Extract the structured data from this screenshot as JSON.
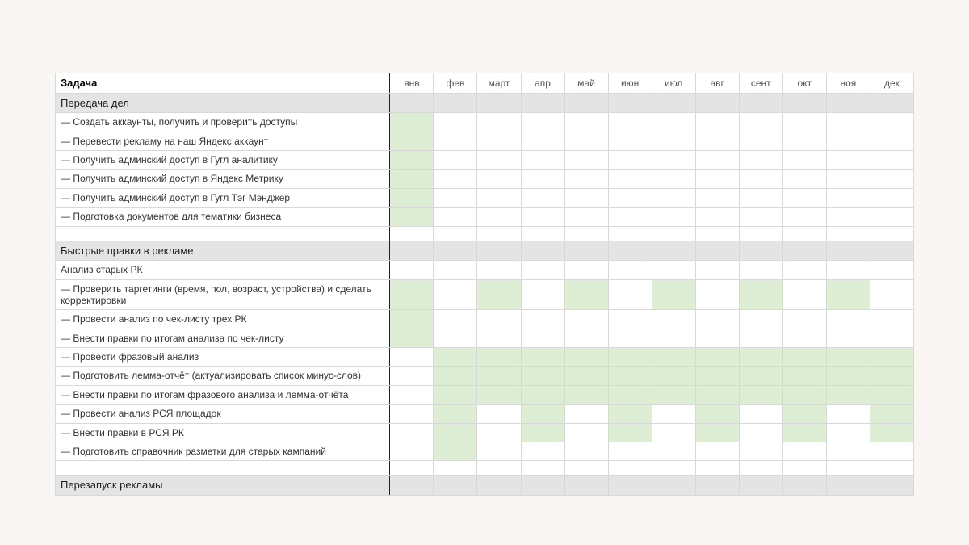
{
  "header": {
    "task": "Задача",
    "months": [
      "янв",
      "фев",
      "март",
      "апр",
      "май",
      "июн",
      "июл",
      "авг",
      "сент",
      "окт",
      "ноя",
      "дек"
    ]
  },
  "sections": [
    {
      "title": "Передача дел",
      "rows": [
        {
          "label": "— Создать аккаунты, получить и проверить доступы",
          "months": [
            1,
            0,
            0,
            0,
            0,
            0,
            0,
            0,
            0,
            0,
            0,
            0
          ]
        },
        {
          "label": "— Перевести рекламу на наш Яндекс аккаунт",
          "months": [
            1,
            0,
            0,
            0,
            0,
            0,
            0,
            0,
            0,
            0,
            0,
            0
          ]
        },
        {
          "label": "— Получить админский доступ в Гугл аналитику",
          "months": [
            1,
            0,
            0,
            0,
            0,
            0,
            0,
            0,
            0,
            0,
            0,
            0
          ]
        },
        {
          "label": "— Получить админский доступ в Яндекс Метрику",
          "months": [
            1,
            0,
            0,
            0,
            0,
            0,
            0,
            0,
            0,
            0,
            0,
            0
          ]
        },
        {
          "label": "— Получить админский доступ в Гугл Тэг Мэнджер",
          "months": [
            1,
            0,
            0,
            0,
            0,
            0,
            0,
            0,
            0,
            0,
            0,
            0
          ]
        },
        {
          "label": "— Подготовка документов для тематики бизнеса",
          "months": [
            1,
            0,
            0,
            0,
            0,
            0,
            0,
            0,
            0,
            0,
            0,
            0
          ]
        }
      ],
      "spacer_after": true
    },
    {
      "title": "Быстрые правки в рекламе",
      "rows": [
        {
          "label": "Анализ старых РК",
          "months": [
            0,
            0,
            0,
            0,
            0,
            0,
            0,
            0,
            0,
            0,
            0,
            0
          ]
        },
        {
          "label": "— Проверить таргетинги (время, пол, возраст, устройства) и сделать корректировки",
          "months": [
            1,
            0,
            1,
            0,
            1,
            0,
            1,
            0,
            1,
            0,
            1,
            0
          ]
        },
        {
          "label": "— Провести анализ по чек-листу трех РК",
          "months": [
            1,
            0,
            0,
            0,
            0,
            0,
            0,
            0,
            0,
            0,
            0,
            0
          ]
        },
        {
          "label": "— Внести правки по итогам анализа по чек-листу",
          "months": [
            1,
            0,
            0,
            0,
            0,
            0,
            0,
            0,
            0,
            0,
            0,
            0
          ]
        },
        {
          "label": "— Провести фразовый анализ",
          "months": [
            0,
            1,
            1,
            1,
            1,
            1,
            1,
            1,
            1,
            1,
            1,
            1
          ]
        },
        {
          "label": "— Подготовить лемма-отчёт (актуализировать список минус-слов)",
          "months": [
            0,
            1,
            1,
            1,
            1,
            1,
            1,
            1,
            1,
            1,
            1,
            1
          ]
        },
        {
          "label": "— Внести правки по итогам фразового анализа и лемма-отчёта",
          "months": [
            0,
            1,
            1,
            1,
            1,
            1,
            1,
            1,
            1,
            1,
            1,
            1
          ]
        },
        {
          "label": "— Провести анализ РСЯ площадок",
          "months": [
            0,
            1,
            0,
            1,
            0,
            1,
            0,
            1,
            0,
            1,
            0,
            1
          ]
        },
        {
          "label": "— Внести правки в РСЯ РК",
          "months": [
            0,
            1,
            0,
            1,
            0,
            1,
            0,
            1,
            0,
            1,
            0,
            1
          ]
        },
        {
          "label": "— Подготовить справочник разметки для старых кампаний",
          "months": [
            0,
            1,
            0,
            0,
            0,
            0,
            0,
            0,
            0,
            0,
            0,
            0
          ]
        }
      ],
      "spacer_after": true
    },
    {
      "title": "Перезапуск рекламы",
      "rows": [],
      "spacer_after": false
    }
  ]
}
